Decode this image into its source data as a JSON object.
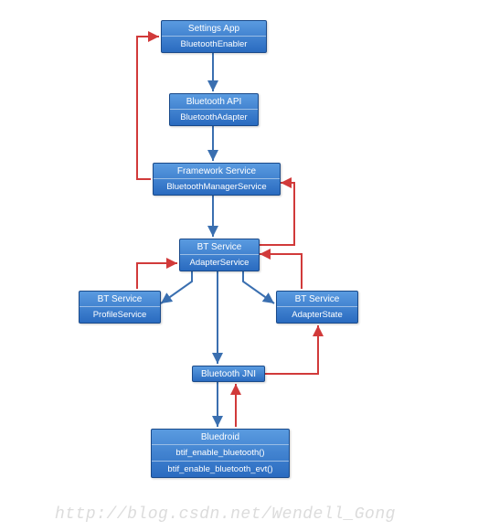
{
  "watermark": "http://blog.csdn.net/Wendell_Gong",
  "nodes": {
    "settings": {
      "title": "Settings App",
      "row1": "BluetoothEnabler"
    },
    "api": {
      "title": "Bluetooth API",
      "row1": "BluetoothAdapter"
    },
    "framework": {
      "title": "Framework Service",
      "row1": "BluetoothManagerService"
    },
    "adapterService": {
      "title": "BT Service",
      "row1": "AdapterService"
    },
    "profileService": {
      "title": "BT Service",
      "row1": "ProfileService"
    },
    "adapterState": {
      "title": "BT Service",
      "row1": "AdapterState"
    },
    "jni": {
      "title": "Bluetooth JNI"
    },
    "bluedroid": {
      "title": "Bluedroid",
      "row1": "btif_enable_bluetooth()",
      "row2": "btif_enable_bluetooth_evt()"
    }
  },
  "arrows": {
    "blue": "#3a6fb0",
    "red": "#d13a3a"
  }
}
